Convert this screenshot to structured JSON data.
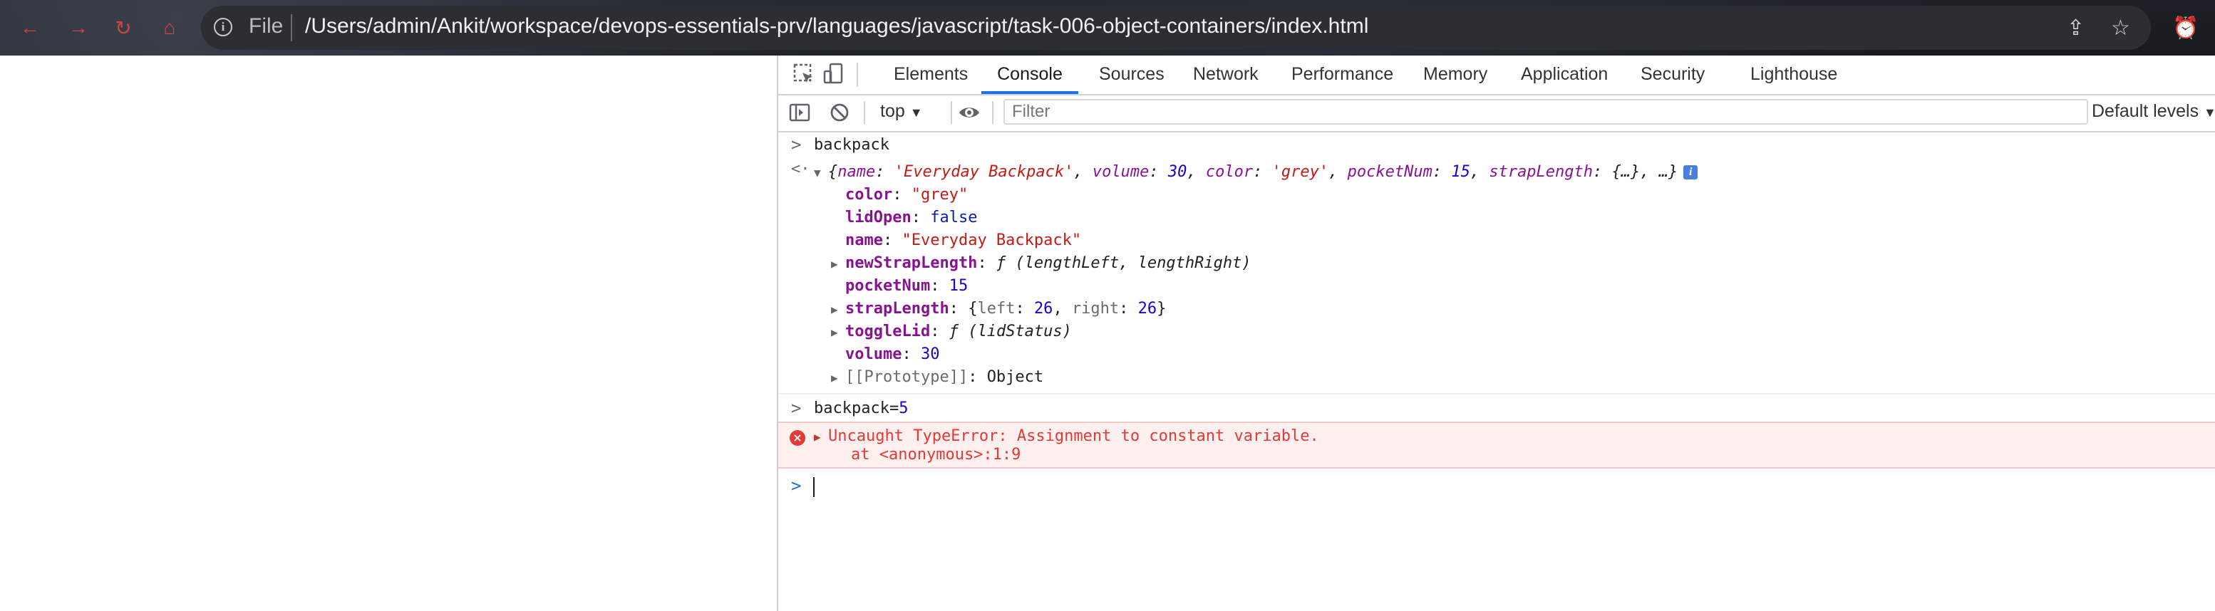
{
  "browser": {
    "file_label": "File",
    "url": "/Users/admin/Ankit/workspace/devops-essentials-prv/languages/javascript/task-006-object-containers/index.html",
    "accent_color": "#d0463b"
  },
  "devtools": {
    "tabs": [
      "Elements",
      "Console",
      "Sources",
      "Network",
      "Performance",
      "Memory",
      "Application",
      "Security",
      "Lighthouse"
    ],
    "active_tab": "Console",
    "context": "top",
    "filter_placeholder": "Filter",
    "levels": "Default levels"
  },
  "console": {
    "input1": "backpack",
    "summary": {
      "open": "{",
      "name_key": "name",
      "name_val": "'Everyday Backpack'",
      "volume_key": "volume",
      "volume_val": "30",
      "color_key": "color",
      "color_val": "'grey'",
      "pocket_key": "pocketNum",
      "pocket_val": "15",
      "strap_key": "strapLength",
      "strap_val": "{…}",
      "close": ", …}"
    },
    "props": {
      "color_key": "color",
      "color_val": "\"grey\"",
      "lid_key": "lidOpen",
      "lid_val": "false",
      "name_key": "name",
      "name_val": "\"Everyday Backpack\"",
      "nsl_key": "newStrapLength",
      "nsl_val": "ƒ (lengthLeft, lengthRight)",
      "pn_key": "pocketNum",
      "pn_val": "15",
      "sl_key": "strapLength",
      "sl_left_key": "left",
      "sl_left_val": "26",
      "sl_right_key": "right",
      "sl_right_val": "26",
      "tl_key": "toggleLid",
      "tl_val": "ƒ (lidStatus)",
      "vol_key": "volume",
      "vol_val": "30",
      "proto": "[[Prototype]]",
      "proto_val": "Object"
    },
    "input2_name": "backpack=",
    "input2_num": "5",
    "error_line1": "Uncaught TypeError: Assignment to constant variable.",
    "error_line2": "at <anonymous>:1:9"
  }
}
